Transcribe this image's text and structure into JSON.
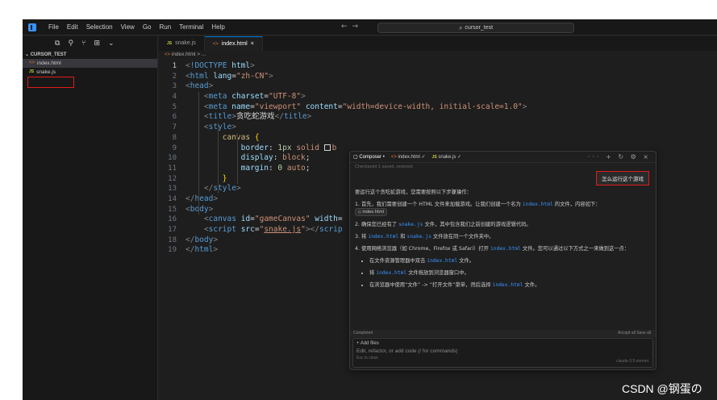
{
  "menu": [
    "File",
    "Edit",
    "Selection",
    "View",
    "Go",
    "Run",
    "Terminal",
    "Help"
  ],
  "nav": {
    "back": "←",
    "forward": "→"
  },
  "search": {
    "value": "cursor_test"
  },
  "sidebar": {
    "toolbar_icons": [
      "files-icon",
      "search-icon",
      "source-control-icon",
      "extensions-icon",
      "chevron-down-icon"
    ],
    "section": "CURSOR_TEST",
    "files": [
      {
        "name": "index.html",
        "type": "html",
        "active": true
      },
      {
        "name": "snake.js",
        "type": "js",
        "active": false
      }
    ]
  },
  "tabs": [
    {
      "label": "snake.js",
      "type": "js",
      "active": false
    },
    {
      "label": "index.html",
      "type": "html",
      "active": true,
      "close": "×"
    }
  ],
  "breadcrumb": "index.html > ...",
  "editor": {
    "line_numbers": [
      "1",
      "2",
      "3",
      "4",
      "5",
      "6",
      "7",
      "8",
      "9",
      "10",
      "11",
      "12",
      "13",
      "14",
      "15",
      "16",
      "17",
      "18",
      "19"
    ],
    "current_line": 1
  },
  "composer": {
    "tabs": [
      "Composer",
      "index.html",
      "snake.js"
    ],
    "controls": "··· + ↻ ⚙ ×",
    "checkpoint": "Checkpoint 1 saved, restored",
    "user_message": "怎么运行这个游戏",
    "intro": "要运行这个贪吃蛇游戏，您需要按照以下步骤操作：",
    "step1_pre": "1. 首先，我们需要创建一个 HTML 文件来加载游戏。让我们创建一个名为 ",
    "step1_code": "index.html",
    "step1_post": " 的文件，内容如下：",
    "file_pill": "◇ index.html",
    "step2_pre": "2. 确保您已经有了 ",
    "step2_code": "snake.js",
    "step2_post": " 文件，其中包含我们之前创建的游戏逻辑代码。",
    "step3_pre": "3. 将 ",
    "step3_code1": "index.html",
    "step3_mid": " 和 ",
    "step3_code2": "snake.js",
    "step3_post": " 文件放在同一个文件夹中。",
    "step4_pre": "4. 使用网络浏览器（如 Chrome、Firefox 或 Safari）打开 ",
    "step4_code": "index.html",
    "step4_post": " 文件。您可以通过以下方式之一来做到这一点：",
    "bullets": [
      {
        "pre": "在文件资源管理器中双击 ",
        "code": "index.html",
        "post": " 文件。"
      },
      {
        "pre": "将 ",
        "code": "index.html",
        "post": " 文件拖放到浏览器窗口中。"
      },
      {
        "pre": "在浏览器中使用“文件” -> “打开文件”菜单，然后选择 ",
        "code": "index.html",
        "post": " 文件。"
      }
    ],
    "status_left": "Completed",
    "status_right": "Accept all   Save all",
    "add_files": "+ Add files",
    "placeholder": "Edit, refactor, or add code (/ for commands)",
    "hint": "Esc to close",
    "model": "claude-3.5-sonnet"
  },
  "watermark": "CSDN @钢蛋の"
}
